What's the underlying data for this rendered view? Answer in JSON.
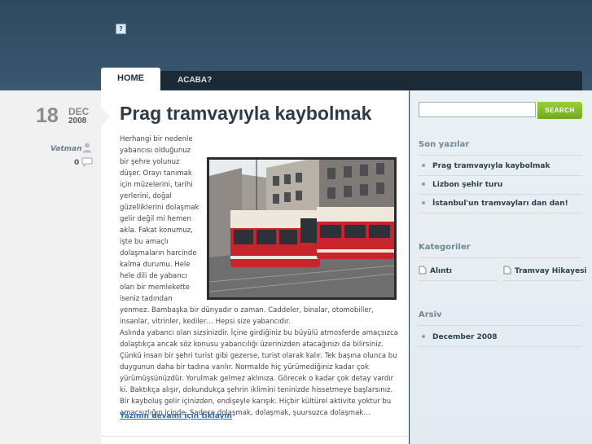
{
  "header": {
    "logo_glyph": "?"
  },
  "nav": {
    "items": [
      {
        "label": "HOME"
      },
      {
        "label": "ACABA?"
      }
    ]
  },
  "post": {
    "date": {
      "day": "18",
      "month": "DEC",
      "year": "2008"
    },
    "author": "Vatman",
    "comment_count": "0",
    "title": "Prag tramvayıyla kaybolmak",
    "body_top": "Herhangi bir nedenle yabancısı olduğunuz bir şehre yolunuz düşer. Orayı tanımak için müzelerini, tarihi yerlerini, doğal güzelliklerini dolaşmak gelir değil mi hemen akla. Fakat konumuz, işte bu amaçlı dolaşmaların harcinde kalma durumu. Hele hele dili de yabancı olan bir memlekette iseniz tadından yenmez. Bambaşka bir dünyadır o zaman. Caddeler, binalar, otomobiller, insanlar, vitrinler, kediler… Hepsi size yabancıdır.",
    "body_bottom": "Aslında yabancı olan sizsinizdir. İçine girdiğiniz bu büyülü atmosferde amaçsızca dolaştıkça ancak söz konusu yabancılığı üzerinizden atacağınızı da bilirsiniz. Çünkü insan bir şehri turist gibi gezerse, turist olarak kalır. Tek başına olunca bu duygunun daha bir tadına varılır. Normalde hiç yürümediğiniz kadar çok yürümüşsünüzdür. Yorulmak gelmez aklınıza. Görecek o kadar çok detay vardır ki. Baktıkça alışır, dokundukça şehrin iklimini teninizde hissetmeye başlarsınız. Bir kayboluş gelir içinizden, endişeyle karışık. Hiçbir kültürel aktivite yoktur bu amaçsızlığın içinde. Sadece dolaşmak, dolaşmak, şuursuzca dolaşmak…",
    "read_more": "Yazının devamı için tıklayın"
  },
  "sidebar": {
    "search": {
      "placeholder": "",
      "button_label": "SEARCH"
    },
    "recent": {
      "title": "Son yazılar",
      "items": [
        {
          "label": "Prag tramvayıyla kaybolmak"
        },
        {
          "label": "Lizbon şehir turu"
        },
        {
          "label": "İstanbul'un tramvayları dan dan!"
        }
      ]
    },
    "categories": {
      "title": "Kategoriler",
      "items": [
        {
          "label": "Alıntı"
        },
        {
          "label": "Tramvay Hikayesi"
        }
      ]
    },
    "archive": {
      "title": "Arsiv",
      "items": [
        {
          "label": "December 2008"
        }
      ]
    }
  },
  "colors": {
    "header": "#2e4a60",
    "navbar": "#1a2a36",
    "search_button": "#86c22b",
    "link": "#2a6fb3",
    "tram_red": "#c8242c"
  },
  "icons": {
    "author": "user-icon",
    "comments": "speech-bubble-icon",
    "category": "document-icon"
  }
}
